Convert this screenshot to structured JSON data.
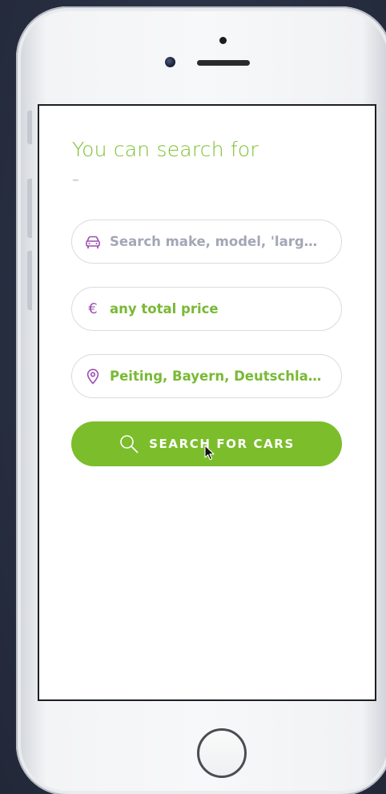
{
  "screen": {
    "heading": "You can search for",
    "heading_suffix": "–"
  },
  "search_form": {
    "make_model_placeholder": "Search make, model, 'large fa...",
    "price_value": "any total price",
    "location_value": "Peiting, Bayern, Deutschland",
    "submit_label": "SEARCH FOR CARS"
  },
  "icons": {
    "make_model": "car-icon",
    "price": "euro-icon",
    "location": "location-pin-icon",
    "submit": "search-icon",
    "euro_glyph": "€"
  },
  "colors": {
    "accent_green": "#7bbd2b",
    "icon_purple": "#9b4fb3",
    "placeholder_gray": "#a3a7b5",
    "field_border": "#d8dbe1"
  }
}
